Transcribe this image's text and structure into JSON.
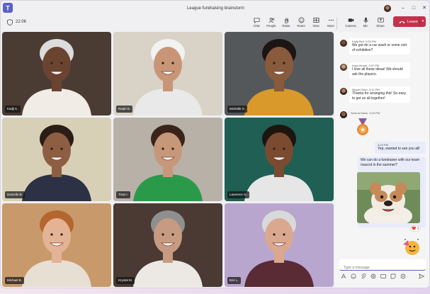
{
  "window": {
    "title": "League fundraising brainstorm",
    "minimize": "–",
    "maximize": "□",
    "close": "✕"
  },
  "toolbar": {
    "elapsed": "22:06",
    "tools": [
      {
        "label": "Chat",
        "icon": "chat-icon"
      },
      {
        "label": "People",
        "icon": "people-icon"
      },
      {
        "label": "Raise",
        "icon": "raise-hand-icon"
      },
      {
        "label": "React",
        "icon": "react-icon"
      },
      {
        "label": "View",
        "icon": "view-icon"
      },
      {
        "label": "More",
        "icon": "more-icon"
      },
      {
        "label": "Camera",
        "icon": "camera-icon"
      },
      {
        "label": "Mic",
        "icon": "mic-icon"
      },
      {
        "label": "Share",
        "icon": "share-icon"
      }
    ],
    "leave_label": "Leave"
  },
  "participants": [
    {
      "name": "Kadji K.",
      "bg": "#4a3b33",
      "skin": "#6b4431",
      "hair": "#dcdcdc",
      "shirt": "#f1ece6"
    },
    {
      "name": "Ralph E.",
      "bg": "#d9d2c7",
      "skin": "#c89677",
      "hair": "#f2f2f2",
      "shirt": "#e9e9e9"
    },
    {
      "name": "Michelle S.",
      "bg": "#55585a",
      "skin": "#8a5a3c",
      "hair": "#1b1614",
      "shirt": "#d99a2b"
    },
    {
      "name": "Danielle B.",
      "bg": "#d8d0b6",
      "skin": "#8e5e42",
      "hair": "#2a1d17",
      "shirt": "#2c3145"
    },
    {
      "name": "Trani I.",
      "bg": "#b7b1a8",
      "skin": "#c7977a",
      "hair": "#3a2419",
      "shirt": "#2a9a4a"
    },
    {
      "name": "Laurence G.",
      "bg": "#1f5f54",
      "skin": "#7a4b31",
      "hair": "#1d1510",
      "shirt": "#e6e6e6"
    },
    {
      "name": "Michael B.",
      "bg": "#c89a6b",
      "skin": "#e4b295",
      "hair": "#b5652e",
      "shirt": "#e8dfd4"
    },
    {
      "name": "Krystal M.",
      "bg": "#4a3a33",
      "skin": "#c79a82",
      "hair": "#8f8f8f",
      "shirt": "#ece9e4"
    },
    {
      "name": "Eric L.",
      "bg": "#b9a6cf",
      "skin": "#d9a88e",
      "hair": "#d9d9d9",
      "shirt": "#5a2a35"
    }
  ],
  "chat": {
    "messages": [
      {
        "sender": "Kadji Bell",
        "time": "3:05 PM",
        "text": "We got do a car wash or some sort of exhibition?"
      },
      {
        "sender": "Kayo Mundi",
        "time": "3:07 PM",
        "text": "I love all these ideas! We should ask the players."
      },
      {
        "sender": "Miguel Silva",
        "time": "3:12 PM",
        "text": "Thanks for arranging this! So easy to get us all together!"
      },
      {
        "sender": "Serena Davis",
        "time": "3:15 PM",
        "text": ""
      }
    ],
    "outgoing": [
      {
        "time": "3:15 PM",
        "text": "Yep, wanted to see you all!"
      },
      {
        "time": "",
        "text": "We can do a fundraiser with our team mascot in the summer?"
      }
    ],
    "reaction": "❤️ 1",
    "compose_placeholder": "Type a message",
    "compose_tools": [
      "format-icon",
      "emoji-icon",
      "attach-icon",
      "loop-icon",
      "gif-icon",
      "sticker-icon",
      "more-icon",
      "send-icon"
    ]
  },
  "colors": {
    "accent": "#5b5fc7",
    "leave": "#c4314b"
  }
}
